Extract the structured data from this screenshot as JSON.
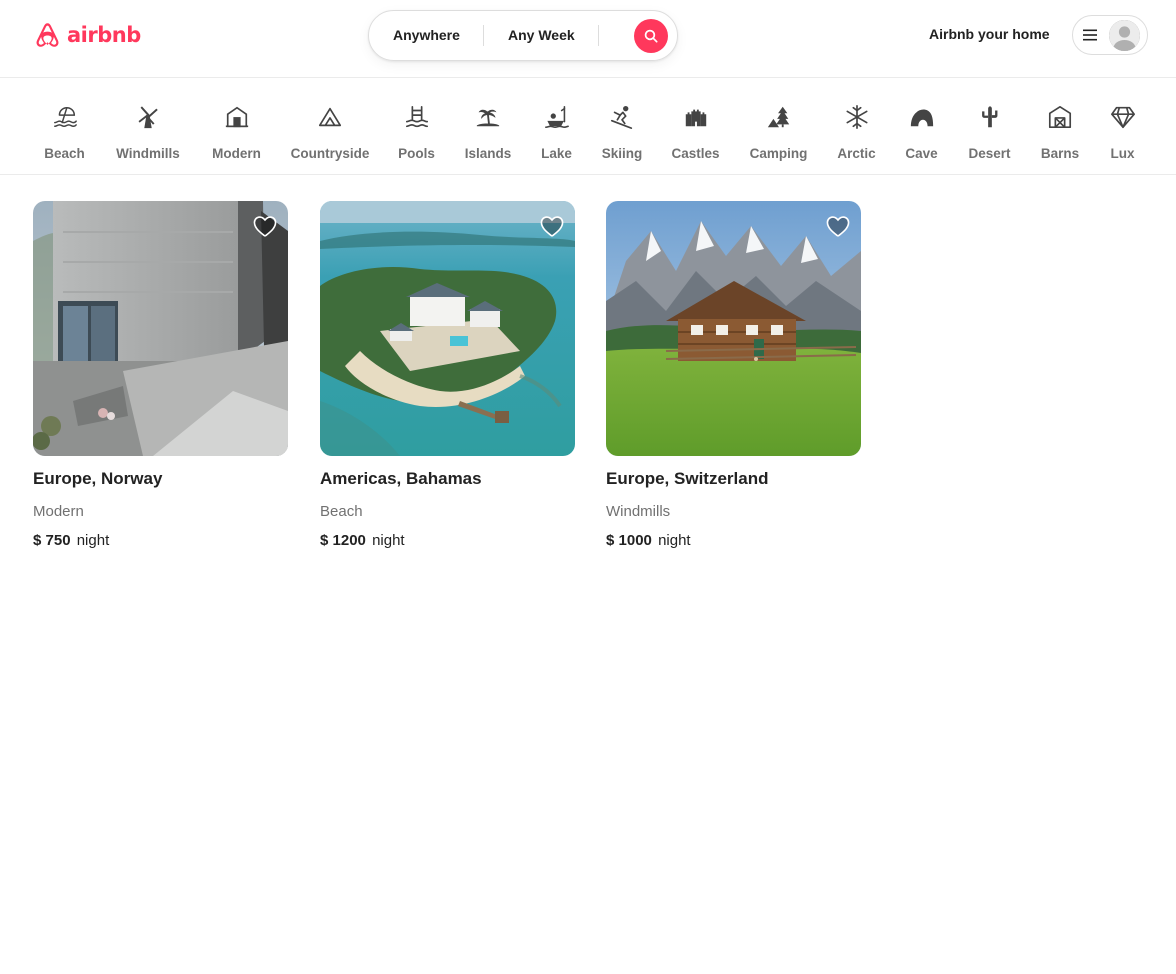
{
  "app": {
    "brand": "airbnb",
    "brand_color": "#ff385c"
  },
  "search": {
    "where_label": "Anywhere",
    "when_label": "Any Week",
    "button_icon": "search-icon"
  },
  "header": {
    "host_link": "Airbnb your home",
    "menu_icon": "menu-icon",
    "avatar_icon": "avatar"
  },
  "categories": [
    {
      "label": "Beach",
      "icon": "beach-icon"
    },
    {
      "label": "Windmills",
      "icon": "windmill-icon"
    },
    {
      "label": "Modern",
      "icon": "modern-house-icon"
    },
    {
      "label": "Countryside",
      "icon": "mountain-icon"
    },
    {
      "label": "Pools",
      "icon": "pool-icon"
    },
    {
      "label": "Islands",
      "icon": "island-icon"
    },
    {
      "label": "Lake",
      "icon": "lake-icon"
    },
    {
      "label": "Skiing",
      "icon": "skiing-icon"
    },
    {
      "label": "Castles",
      "icon": "castle-icon"
    },
    {
      "label": "Camping",
      "icon": "camping-icon"
    },
    {
      "label": "Arctic",
      "icon": "snowflake-icon"
    },
    {
      "label": "Cave",
      "icon": "cave-icon"
    },
    {
      "label": "Desert",
      "icon": "cactus-icon"
    },
    {
      "label": "Barns",
      "icon": "barn-icon"
    },
    {
      "label": "Lux",
      "icon": "diamond-icon"
    }
  ],
  "listings": [
    {
      "title": "Europe, Norway",
      "category": "Modern",
      "currency": "$",
      "price": "750",
      "price_display": "$ 750",
      "unit": "night"
    },
    {
      "title": "Americas, Bahamas",
      "category": "Beach",
      "currency": "$",
      "price": "1200",
      "price_display": "$ 1200",
      "unit": "night"
    },
    {
      "title": "Europe, Switzerland",
      "category": "Windmills",
      "currency": "$",
      "price": "1000",
      "price_display": "$ 1000",
      "unit": "night"
    }
  ]
}
